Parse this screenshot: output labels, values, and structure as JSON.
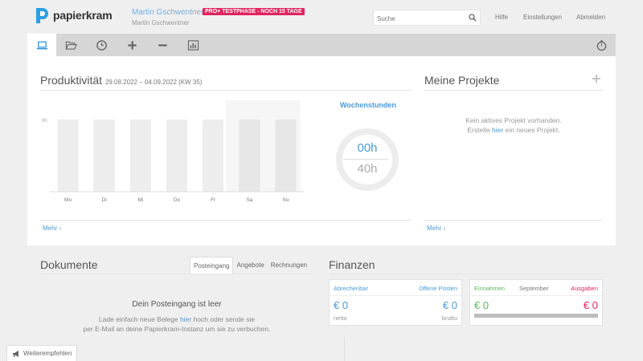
{
  "header": {
    "logo_text": "papierkram",
    "user_name": "Martin Gschwentner",
    "user_sub": "Martin Gschwentner",
    "trial_badge": "PRO+ TESTPHASE - NOCH 15 TAGE",
    "search_placeholder": "Suche",
    "links": [
      "Hilfe",
      "Einstellungen",
      "Abmelden"
    ]
  },
  "toolbar": {
    "items": [
      {
        "icon": "laptop-icon",
        "active": true
      },
      {
        "icon": "folder-open-icon",
        "active": false
      },
      {
        "icon": "clock-icon",
        "active": false
      },
      {
        "icon": "plus-icon",
        "active": false
      },
      {
        "icon": "minus-icon",
        "active": false
      },
      {
        "icon": "bar-chart-icon",
        "active": false
      }
    ],
    "right_icon": "stopwatch-icon"
  },
  "productivity": {
    "title": "Produktivität",
    "range": "29.08.2022 – 04.09.2022 (KW 35)",
    "more": "Mehr"
  },
  "chart_data": {
    "type": "bar",
    "categories": [
      "Mo",
      "Di",
      "Mi",
      "Do",
      "Fr",
      "Sa",
      "So"
    ],
    "values": [
      0,
      0,
      0,
      0,
      0,
      0,
      0
    ],
    "y_tick_label": "8h"
  },
  "weekly_hours": {
    "title": "Wochenstunden",
    "value": "00h",
    "max": "40h",
    "progress": 0
  },
  "projects": {
    "title": "Meine Projekte",
    "empty_line1": "Kein aktives Projekt vorhanden.",
    "empty_pre": "Erstelle",
    "empty_link": "hier",
    "empty_post": "ein neues Projekt.",
    "more": "Mehr"
  },
  "documents": {
    "title": "Dokumente",
    "tabs": [
      "Posteingang",
      "Angebote",
      "Rechnungen"
    ],
    "active_tab": 0,
    "empty_title": "Dein Posteingang ist leer",
    "empty_pre": "Lade einfach neue Belege",
    "empty_link": "hier",
    "empty_post": "hoch oder sende sie",
    "empty_line2": "per E-Mail an deine Papierkram-Instanz um sie zu verbuchen."
  },
  "finance": {
    "title": "Finanzen",
    "card1": {
      "left_label": "Abrechenbar",
      "right_label": "Offene Posten",
      "left_value": "€ 0",
      "right_value": "€ 0",
      "left_sub": "netto",
      "right_sub": "brutto"
    },
    "card2": {
      "income_label": "Einnahmen",
      "month_label": "September",
      "expense_label": "Ausgaben",
      "income_value": "€ 0",
      "expense_value": "€ 0"
    }
  },
  "recommend": {
    "label": "Weiterempfehlen"
  },
  "colors": {
    "accent": "#4a9ad8",
    "income": "#5cb85c",
    "expense": "#e0245e",
    "badge": "#e0245e"
  }
}
